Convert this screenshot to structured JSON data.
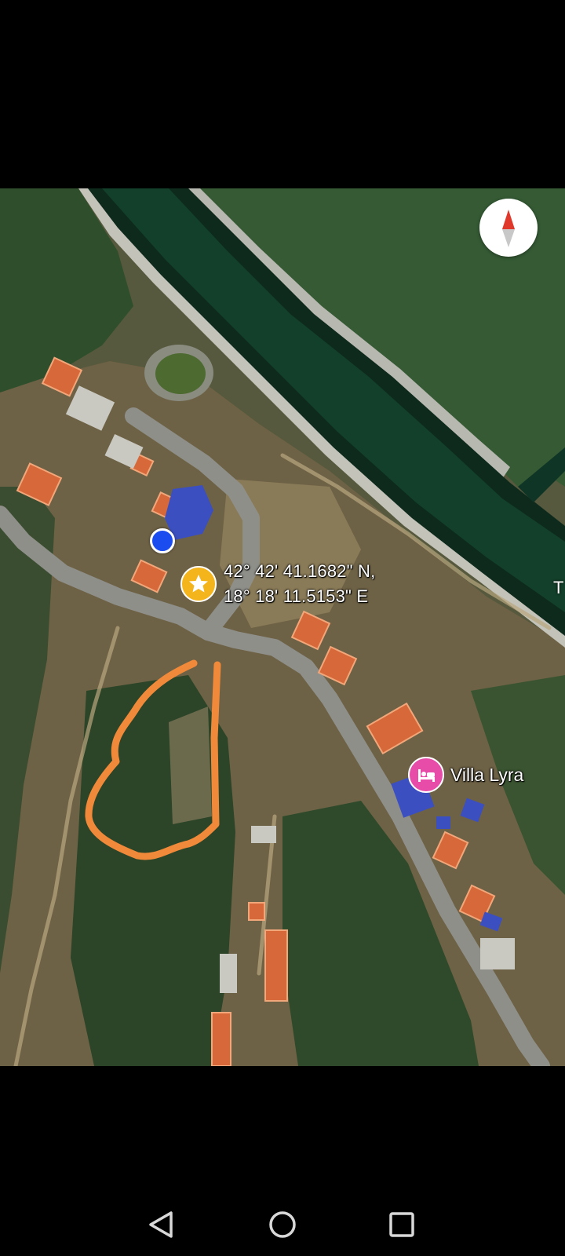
{
  "map": {
    "coordinates_line1": "42° 42' 41.1682\" N,",
    "coordinates_line2": "18° 18' 11.5153\" E",
    "place_label": "Villa Lyra",
    "edge_label": "T",
    "place_icon": "hotel-bed-icon",
    "pin_icon": "star-icon",
    "colors": {
      "location_dot": "#1a4cf0",
      "star_pin": "#f3b41c",
      "place_pin": "#e64ca8",
      "drawn_outline": "#f08a3a"
    }
  },
  "compass": {
    "icon": "compass-needle-icon"
  },
  "navigation_bar": {
    "back_icon": "back-triangle-icon",
    "home_icon": "home-circle-icon",
    "recents_icon": "recents-square-icon"
  }
}
